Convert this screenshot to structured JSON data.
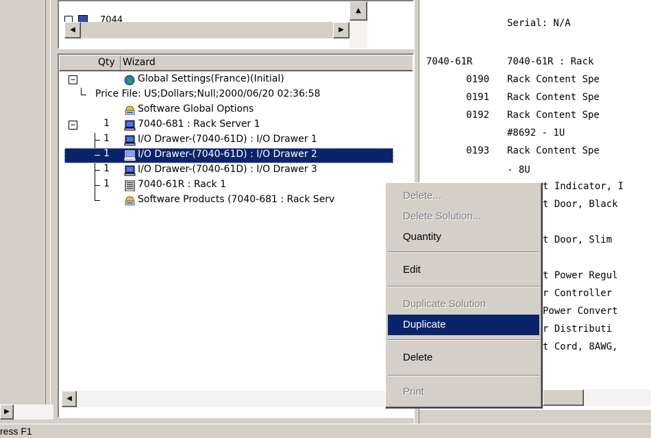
{
  "top_pane": {
    "partial_item": "7044"
  },
  "tree": {
    "header": {
      "qty": "Qty",
      "wizard": "Wizard"
    },
    "rows": [
      {
        "qty": "",
        "label": "Global Settings(France)(Initial)",
        "icon": "globe-icon"
      },
      {
        "qty": "",
        "label": "Price File: US;Dollars;Null;2000/06/20 02:36:58",
        "icon": ""
      },
      {
        "qty": "",
        "label": "Software Global Options",
        "icon": "software-package-icon"
      },
      {
        "qty": "1",
        "label": "7040-681 : Rack Server 1",
        "icon": "server-icon"
      },
      {
        "qty": "1",
        "label": "I/O Drawer-(7040-61D) : I/O Drawer 1",
        "icon": "drawer-icon"
      },
      {
        "qty": "1",
        "label": "I/O Drawer-(7040-61D) : I/O Drawer 2",
        "icon": "drawer-icon",
        "selected": true
      },
      {
        "qty": "1",
        "label": "I/O Drawer-(7040-61D) : I/O Drawer 3",
        "icon": "drawer-icon"
      },
      {
        "qty": "1",
        "label": "7040-61R : Rack 1",
        "icon": "rack-icon"
      },
      {
        "qty": "",
        "label": "Software Products (7040-681 : Rack Serv",
        "icon": "software-package-icon"
      }
    ]
  },
  "report": {
    "lines": [
      {
        "code": "",
        "text": "Serial: N/A"
      },
      {
        "code": "7040-61R",
        "text": "7040-61R : Rack"
      },
      {
        "code": "0190",
        "text": "Rack Content Spe"
      },
      {
        "code": "0191",
        "text": "Rack Content Spe"
      },
      {
        "code": "0192",
        "text": "Rack Content Spe"
      },
      {
        "code": "",
        "text": "#8692 - 1U"
      },
      {
        "code": "0193",
        "text": "Rack Content Spe"
      },
      {
        "code": "",
        "text": "- 8U"
      },
      {
        "code": "",
        "text": "t Indicator, I"
      },
      {
        "code": "",
        "text": "t Door, Black"
      },
      {
        "code": "",
        "text": "t Door, Slim"
      },
      {
        "code": "",
        "text": "t Power Regul"
      },
      {
        "code": "",
        "text": "r Controller"
      },
      {
        "code": "",
        "text": "Power Convert"
      },
      {
        "code": "",
        "text": "r Distributi"
      },
      {
        "code": "",
        "text": "t Cord, 8AWG,"
      }
    ]
  },
  "context_menu": {
    "items": [
      {
        "label": "Delete...",
        "disabled": true
      },
      {
        "label": "Delete Solution...",
        "disabled": true
      },
      {
        "label": "Quantity",
        "disabled": false
      },
      {
        "label": "Edit",
        "disabled": false
      },
      {
        "label": "Duplicate Solution",
        "disabled": true
      },
      {
        "label": "Duplicate",
        "disabled": false,
        "highlighted": true
      },
      {
        "label": "Delete",
        "disabled": false
      },
      {
        "label": "Print",
        "disabled": true
      }
    ]
  },
  "status_bar": {
    "text": "ress F1"
  },
  "colors": {
    "selection": "#0a246a",
    "face": "#d4d0c8",
    "disabled_text": "#808080"
  }
}
